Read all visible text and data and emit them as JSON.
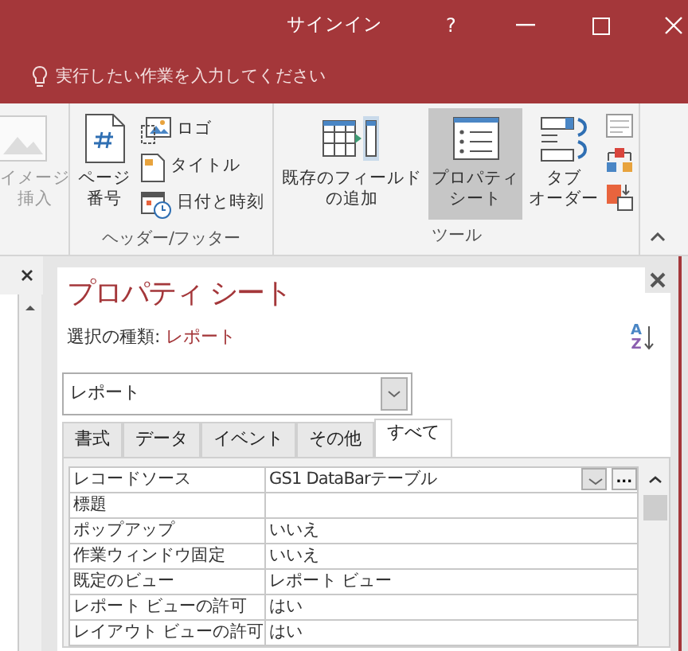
{
  "window": {
    "sign_in": "サインイン",
    "help": "?"
  },
  "tell_me": {
    "placeholder": "実行したい作業を入力してください"
  },
  "ribbon": {
    "partial_button": {
      "lines": [
        "イメージ",
        "挿入"
      ],
      "disabled": true
    },
    "groups": [
      {
        "label": "ヘッダー/フッター",
        "buttons": [
          {
            "kind": "large",
            "lines": [
              "ページ",
              "番号"
            ],
            "selected": false
          },
          {
            "kind": "small",
            "lines": [
              "ロゴ"
            ],
            "selected": false
          },
          {
            "kind": "small",
            "lines": [
              "タイトル"
            ],
            "selected": false
          },
          {
            "kind": "small",
            "lines": [
              "日付と時刻"
            ],
            "selected": false
          }
        ]
      },
      {
        "label": "ツール",
        "buttons": [
          {
            "kind": "large",
            "lines": [
              "既存のフィールド",
              "の追加"
            ],
            "selected": false
          },
          {
            "kind": "large",
            "lines": [
              "プロパティ",
              "シート"
            ],
            "selected": true
          },
          {
            "kind": "large",
            "lines": [
              "タブ",
              "オーダー"
            ],
            "selected": false
          },
          {
            "kind": "icons"
          }
        ]
      }
    ]
  },
  "property_sheet": {
    "title": "プロパティ シート",
    "selection_type": {
      "label": "選択の種類:",
      "value": "レポート"
    },
    "sort_button": {
      "top": "A",
      "bottom": "Z"
    },
    "object_select": {
      "value": "レポート"
    },
    "tabs": [
      {
        "label": "書式",
        "selected": false
      },
      {
        "label": "データ",
        "selected": false
      },
      {
        "label": "イベント",
        "selected": false
      },
      {
        "label": "その他",
        "selected": false
      },
      {
        "label": "すべて",
        "selected": true
      }
    ],
    "builder_button": "...",
    "properties": [
      {
        "name": "レコードソース",
        "value": "GS1 DataBarテーブル",
        "kind": "combo"
      },
      {
        "name": "標題",
        "kind": "text"
      },
      {
        "name": "ポップアップ",
        "value": "いいえ",
        "kind": "text"
      },
      {
        "name": "作業ウィンドウ固定",
        "value": "いいえ",
        "kind": "text"
      },
      {
        "name": "既定のビュー",
        "value": "レポート ビュー",
        "kind": "text"
      },
      {
        "name": "レポート ビューの許可",
        "value": "はい",
        "kind": "text"
      },
      {
        "name": "レイアウト ビューの許可",
        "value": "はい",
        "kind": "text"
      }
    ]
  }
}
